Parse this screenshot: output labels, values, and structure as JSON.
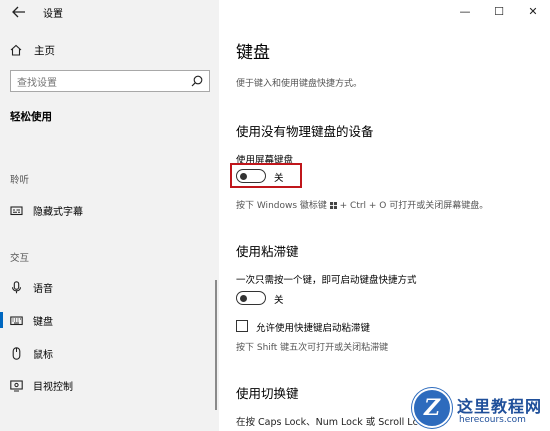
{
  "window": {
    "title": "设置",
    "controls": {
      "minimize": "—",
      "maximize": "☐",
      "close": "✕"
    }
  },
  "sidebar": {
    "home_label": "主页",
    "search_placeholder": "查找设置",
    "category": "轻松使用",
    "sections": [
      {
        "header": "聆听",
        "items": [
          {
            "label": "隐藏式字幕",
            "icon": "captions-icon"
          }
        ]
      },
      {
        "header": "交互",
        "items": [
          {
            "label": "语音",
            "icon": "microphone-icon"
          },
          {
            "label": "键盘",
            "icon": "keyboard-icon",
            "active": true
          },
          {
            "label": "鼠标",
            "icon": "mouse-icon"
          },
          {
            "label": "目视控制",
            "icon": "eye-control-icon"
          }
        ]
      }
    ]
  },
  "main": {
    "title": "键盘",
    "description": "便于键入和使用键盘快捷方式。",
    "osk": {
      "heading": "使用没有物理键盘的设备",
      "toggle_label": "使用屏幕键盘",
      "toggle_state": "关",
      "hint_before": "按下 Windows 徽标键 ",
      "hint_after": " + Ctrl + O 可打开或关闭屏幕键盘。"
    },
    "sticky": {
      "heading": "使用粘滞键",
      "toggle_label": "一次只需按一个键，即可启动键盘快捷方式",
      "toggle_state": "关",
      "checkbox_label": "允许使用快捷键启动粘滞键",
      "hint": "按下 Shift 键五次可打开或关闭粘滞键"
    },
    "toggle_keys": {
      "heading": "使用切换键",
      "text": "在按 Caps Lock、Num Lock 或 Scroll Lc"
    }
  },
  "watermark": {
    "logo_letter": "Z",
    "name": "这里教程网",
    "url": "herecours.com"
  },
  "colors": {
    "accent": "#0067c0",
    "highlight": "#c0161b",
    "watermark": "#1f4f9a"
  }
}
